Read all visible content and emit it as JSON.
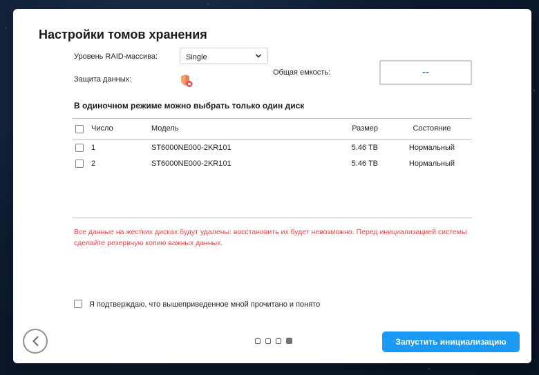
{
  "dialog": {
    "title": "Настройки томов хранения",
    "raid": {
      "label": "Уровень RAID-массива:",
      "selected": "Single"
    },
    "protection": {
      "label": "Защита данных:",
      "icon": "shield-error-icon"
    },
    "capacity": {
      "label": "Общая емкость:",
      "value": "--"
    },
    "single_mode_note": "В одиночном режиме можно выбрать только один диск",
    "table": {
      "columns": [
        "Число",
        "Модель",
        "Размер",
        "Состояние"
      ],
      "rows": [
        {
          "num": "1",
          "model": "ST6000NE000-2KR101",
          "size": "5.46 TB",
          "state": "Нормальный"
        },
        {
          "num": "2",
          "model": "ST6000NE000-2KR101",
          "size": "5.46 TB",
          "state": "Нормальный"
        }
      ]
    },
    "warning": "Все данные на жестких дисках будут удалены: восстановить их будет невозможно. Перед инициализацией системы сделайте резервную копию важных данных.",
    "confirm_label": "Я подтверждаю, что вышеприведенное мной прочитано и понято",
    "pager": {
      "total": 4,
      "current": 4
    },
    "primary_button": "Запустить инициализацию",
    "colors": {
      "accent": "#1a9af5",
      "warning": "#e0454b",
      "capacity_value": "#2f7fe0"
    }
  }
}
